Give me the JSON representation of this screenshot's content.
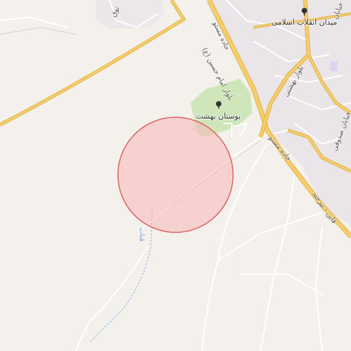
{
  "map": {
    "colors": {
      "background": "#f4f1ed",
      "urban": "#e8e4e6",
      "park": "#cfe6bb",
      "highway": "#f5cd6a",
      "highway_casing": "#e0b24a",
      "minor_road": "#ffffff",
      "water": "#9cc1e6",
      "marker_fill": "#f7b6b6",
      "marker_stroke": "#e06060"
    },
    "labels": {
      "park": "بوستان بهشت",
      "square": "میدان انقلاب اسلامی",
      "boulevard_imam_hossein": "بلوار امام حسین (ع)",
      "boulevard_beheshti": "بلوار بهشتی",
      "road_mastu_upper": "جاده مستو",
      "road_mastu_lower": "جاده مستو",
      "road_qaen_birjand": "قاین - بیرجند",
      "street_sadoughi": "خیابان صدوقی",
      "street_top_right": "خیابان",
      "street_top_left": "توق",
      "canal": "قنات"
    },
    "icons": {
      "park": "tree-icon",
      "square": "tree-icon"
    },
    "marker": {
      "type": "circle",
      "shape": "search-radius-circle"
    }
  }
}
